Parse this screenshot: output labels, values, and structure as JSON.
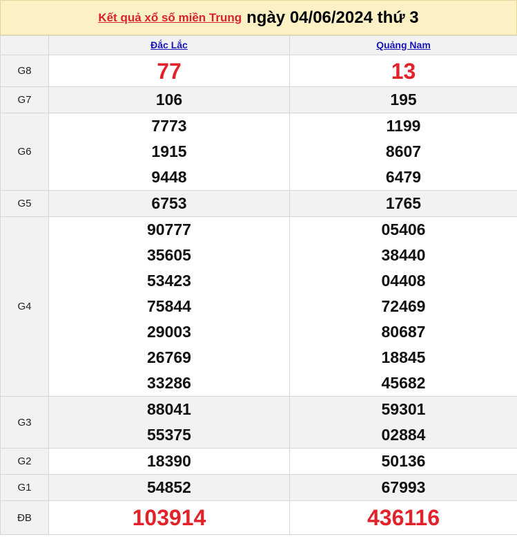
{
  "header": {
    "link_text": "Kết quả xổ số miền Trung",
    "date_text": "ngày 04/06/2024 thứ 3"
  },
  "provinces": [
    "Đắc Lắc",
    "Quảng Nam"
  ],
  "prizes": [
    {
      "label": "G8",
      "p1": [
        "77"
      ],
      "p2": [
        "13"
      ]
    },
    {
      "label": "G7",
      "p1": [
        "106"
      ],
      "p2": [
        "195"
      ]
    },
    {
      "label": "G6",
      "p1": [
        "7773",
        "1915",
        "9448"
      ],
      "p2": [
        "1199",
        "8607",
        "6479"
      ]
    },
    {
      "label": "G5",
      "p1": [
        "6753"
      ],
      "p2": [
        "1765"
      ]
    },
    {
      "label": "G4",
      "p1": [
        "90777",
        "35605",
        "53423",
        "75844",
        "29003",
        "26769",
        "33286"
      ],
      "p2": [
        "05406",
        "38440",
        "04408",
        "72469",
        "80687",
        "18845",
        "45682"
      ]
    },
    {
      "label": "G3",
      "p1": [
        "88041",
        "55375"
      ],
      "p2": [
        "59301",
        "02884"
      ]
    },
    {
      "label": "G2",
      "p1": [
        "18390"
      ],
      "p2": [
        "50136"
      ]
    },
    {
      "label": "G1",
      "p1": [
        "54852"
      ],
      "p2": [
        "67993"
      ]
    },
    {
      "label": "ĐB",
      "p1": [
        "103914"
      ],
      "p2": [
        "436116"
      ]
    }
  ],
  "colors": {
    "accent_red": "#e2222b",
    "link_blue": "#1414b8",
    "header_bg": "#fcf1c5"
  }
}
